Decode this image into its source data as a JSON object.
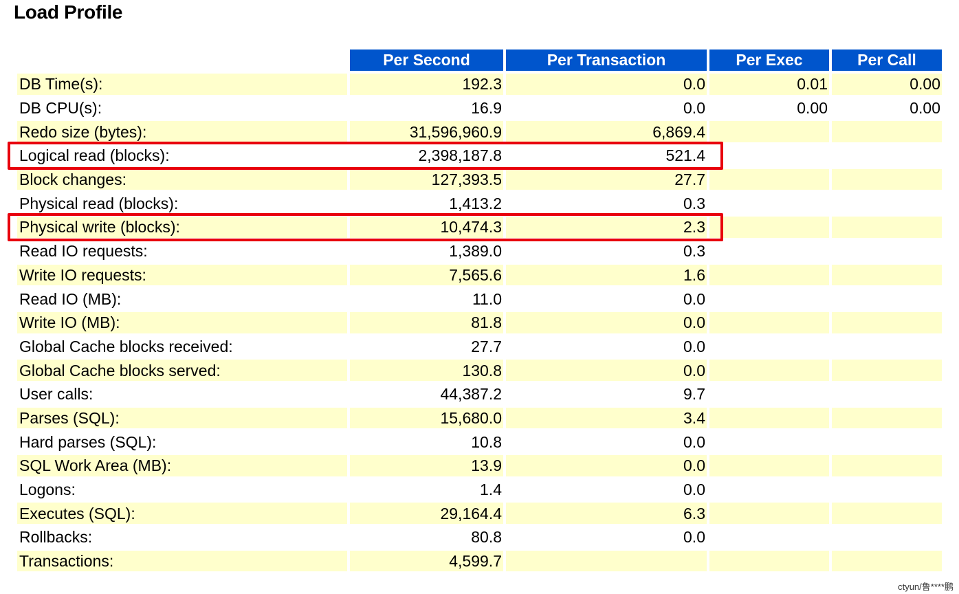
{
  "title": "Load Profile",
  "columns": [
    "",
    "Per Second",
    "Per Transaction",
    "Per Exec",
    "Per Call"
  ],
  "rows": [
    {
      "name": "DB Time(s):",
      "per_second": "192.3",
      "per_transaction": "0.0",
      "per_exec": "0.01",
      "per_call": "0.00"
    },
    {
      "name": "DB CPU(s):",
      "per_second": "16.9",
      "per_transaction": "0.0",
      "per_exec": "0.00",
      "per_call": "0.00"
    },
    {
      "name": "Redo size (bytes):",
      "per_second": "31,596,960.9",
      "per_transaction": "6,869.4",
      "per_exec": "",
      "per_call": ""
    },
    {
      "name": "Logical read (blocks):",
      "per_second": "2,398,187.8",
      "per_transaction": "521.4",
      "per_exec": "",
      "per_call": ""
    },
    {
      "name": "Block changes:",
      "per_second": "127,393.5",
      "per_transaction": "27.7",
      "per_exec": "",
      "per_call": ""
    },
    {
      "name": "Physical read (blocks):",
      "per_second": "1,413.2",
      "per_transaction": "0.3",
      "per_exec": "",
      "per_call": ""
    },
    {
      "name": "Physical write (blocks):",
      "per_second": "10,474.3",
      "per_transaction": "2.3",
      "per_exec": "",
      "per_call": ""
    },
    {
      "name": "Read IO requests:",
      "per_second": "1,389.0",
      "per_transaction": "0.3",
      "per_exec": "",
      "per_call": ""
    },
    {
      "name": "Write IO requests:",
      "per_second": "7,565.6",
      "per_transaction": "1.6",
      "per_exec": "",
      "per_call": ""
    },
    {
      "name": "Read IO (MB):",
      "per_second": "11.0",
      "per_transaction": "0.0",
      "per_exec": "",
      "per_call": ""
    },
    {
      "name": "Write IO (MB):",
      "per_second": "81.8",
      "per_transaction": "0.0",
      "per_exec": "",
      "per_call": ""
    },
    {
      "name": "Global Cache blocks received:",
      "per_second": "27.7",
      "per_transaction": "0.0",
      "per_exec": "",
      "per_call": ""
    },
    {
      "name": "Global Cache blocks served:",
      "per_second": "130.8",
      "per_transaction": "0.0",
      "per_exec": "",
      "per_call": ""
    },
    {
      "name": "User calls:",
      "per_second": "44,387.2",
      "per_transaction": "9.7",
      "per_exec": "",
      "per_call": ""
    },
    {
      "name": "Parses (SQL):",
      "per_second": "15,680.0",
      "per_transaction": "3.4",
      "per_exec": "",
      "per_call": ""
    },
    {
      "name": "Hard parses (SQL):",
      "per_second": "10.8",
      "per_transaction": "0.0",
      "per_exec": "",
      "per_call": ""
    },
    {
      "name": "SQL Work Area (MB):",
      "per_second": "13.9",
      "per_transaction": "0.0",
      "per_exec": "",
      "per_call": ""
    },
    {
      "name": "Logons:",
      "per_second": "1.4",
      "per_transaction": "0.0",
      "per_exec": "",
      "per_call": ""
    },
    {
      "name": "Executes (SQL):",
      "per_second": "29,164.4",
      "per_transaction": "6.3",
      "per_exec": "",
      "per_call": ""
    },
    {
      "name": "Rollbacks:",
      "per_second": "80.8",
      "per_transaction": "0.0",
      "per_exec": "",
      "per_call": ""
    },
    {
      "name": "Transactions:",
      "per_second": "4,599.7",
      "per_transaction": "",
      "per_exec": "",
      "per_call": ""
    }
  ],
  "highlighted_rows": [
    "Logical read (blocks):",
    "Physical write (blocks):"
  ],
  "colors": {
    "header_bg": "#0055cc",
    "row_odd": "#ffffcc",
    "highlight": "#e8000c"
  },
  "watermark": "ctyun/鲁****鹏"
}
